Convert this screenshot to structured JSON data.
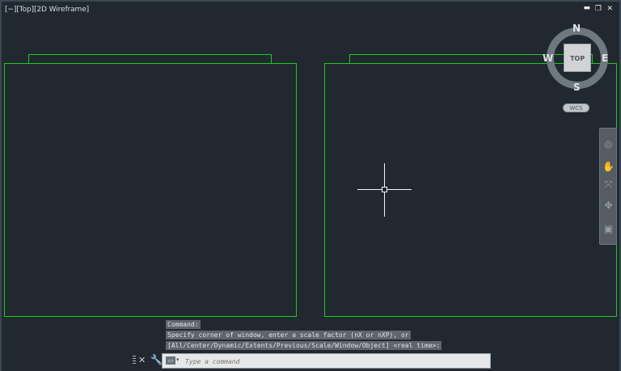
{
  "viewport": {
    "label": "[−][Top][2D Wireframe]"
  },
  "window_controls": {
    "minimize": "▬",
    "restore": "❐",
    "close": "✕"
  },
  "viewcube": {
    "face": "TOP",
    "north": "N",
    "south": "S",
    "east": "E",
    "west": "W"
  },
  "wcs": {
    "label": "WCS"
  },
  "navbar": {
    "icons": [
      "steering-wheel-icon",
      "pan-icon",
      "zoom-icon",
      "orbit-icon",
      "showmotion-icon"
    ],
    "glyphs": [
      "◎",
      "✋",
      "⤧",
      "✥",
      "▣"
    ]
  },
  "command": {
    "history": [
      "Command:",
      "Specify corner of window, enter a scale factor (nX or nXP), or",
      "[All/Center/Dynamic/Extents/Previous/Scale/Window/Object] <real time>:"
    ],
    "placeholder": "Type a command",
    "close_glyph": "✕",
    "customize_glyph": "🔧",
    "prompt_glyph": "▭",
    "dropdown_glyph": "▾"
  },
  "colors": {
    "background": "#212830",
    "geometry": "#1fc81f",
    "crosshair": "#f4f4f4"
  }
}
